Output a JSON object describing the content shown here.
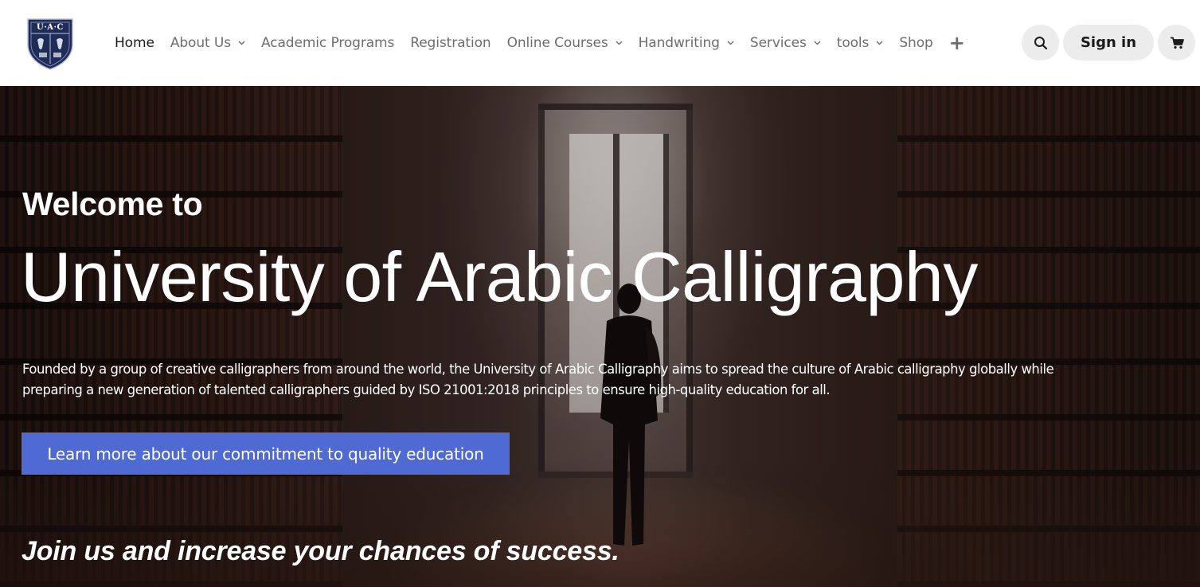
{
  "brand": {
    "logo_text": "U·A·C",
    "colors": {
      "navy": "#1f2c57",
      "accent_button": "#4f6bd3",
      "nav_text": "#6d6d6d",
      "pill_bg": "#ececec"
    }
  },
  "nav": {
    "items": [
      {
        "label": "Home",
        "has_dropdown": false,
        "active": true
      },
      {
        "label": "About Us",
        "has_dropdown": true
      },
      {
        "label": "Academic Programs",
        "has_dropdown": false
      },
      {
        "label": "Registration",
        "has_dropdown": false
      },
      {
        "label": "Online Courses",
        "has_dropdown": true
      },
      {
        "label": "Handwriting",
        "has_dropdown": true
      },
      {
        "label": "Services",
        "has_dropdown": true
      },
      {
        "label": "tools",
        "has_dropdown": true
      },
      {
        "label": "Shop",
        "has_dropdown": false
      }
    ],
    "plus_icon": "+",
    "search_icon": "search-icon",
    "signin_label": "Sign in",
    "cart_icon": "cart-icon"
  },
  "hero": {
    "welcome": "Welcome to",
    "title": "University of Arabic Calligraphy",
    "description": "Founded by a group of creative calligraphers from around the world, the University of Arabic Calligraphy aims to spread the culture of Arabic calligraphy globally while preparing a new generation of talented calligraphers guided by ISO 21001:2018 principles to ensure high-quality education for all.",
    "cta_label": "Learn more about our commitment to quality education",
    "tagline": "Join us and increase your chances of success."
  }
}
